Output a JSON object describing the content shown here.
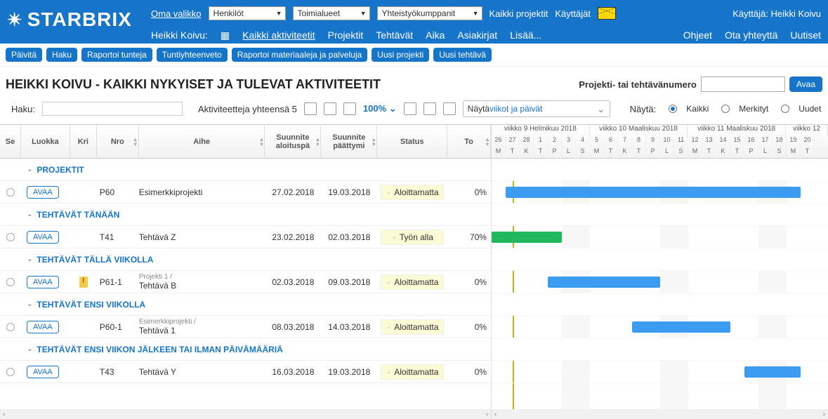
{
  "brand": "STARBRIX",
  "top": {
    "oma_valikko": "Oma valikko",
    "sel_henkilot": "Henkilöt",
    "sel_toimialueet": "Toimialueet",
    "sel_yhteistyo": "Yhteistyökumppanit",
    "kaikki_projektit": "Kaikki projektit",
    "kayttajat": "Käyttäjät",
    "user_prefix": "Käyttäjä:",
    "user_name": "Heikki Koivu"
  },
  "nav": {
    "user": "Heikki Koivu:",
    "kaikki_aktiviteetit": "Kaikki aktiviteetit",
    "projektit": "Projektit",
    "tehtavat": "Tehtävät",
    "aika": "Aika",
    "asiakirjat": "Asiakirjat",
    "lisaa": "Lisää...",
    "ohjeet": "Ohjeet",
    "ota_yhteytta": "Ota yhteyttä",
    "uutiset": "Uutiset"
  },
  "pills": {
    "paivita": "Päivitä",
    "haku": "Haku",
    "raportoi_tunteja": "Raportoi tunteja",
    "tuntiyhteenveto": "Tuntiyhteenveto",
    "raportoi_mat": "Raportoi materiaaleja ja palveluja",
    "uusi_projekti": "Uusi projekti",
    "uusi_tehtava": "Uusi tehtävä"
  },
  "title": "HEIKKI KOIVU - KAIKKI NYKYISET JA TULEVAT AKTIVITEETIT",
  "proj_search_label": "Projekti- tai tehtävänumero",
  "open_btn": "Avaa",
  "haku_label": "Haku:",
  "act_count": "Aktiviteetteja yhteensä 5",
  "zoom": "100%",
  "view_select_prefix": "Näytä ",
  "view_select_value": "viikot ja päivät",
  "show_label": "Näytä:",
  "radio_kaikki": "Kaikki",
  "radio_merkityt": "Merkityt",
  "radio_uudet": "Uudet",
  "cols": {
    "sel": "Se",
    "luokka": "Luokka",
    "kri": "Kri",
    "nro": "Nro",
    "aihe": "Aihe",
    "start": "Suunnite aloituspä",
    "end": "Suunnite päättymi",
    "status": "Status",
    "pct": "To"
  },
  "groups": {
    "g1": "PROJEKTIT",
    "g2": "TEHTÄVÄT TÄNÄÄN",
    "g3": "TEHTÄVÄT TÄLLÄ VIIKOLLA",
    "g4": "TEHTÄVÄT ENSI VIIKOLLA",
    "g5": "TEHTÄVÄT ENSI VIIKON JÄLKEEN TAI ILMAN PÄIVÄMÄÄRIÄ"
  },
  "rows": [
    {
      "avaa": "AVAA",
      "nro": "P60",
      "aihe": "Esimerkkiprojekti",
      "sub": "",
      "start": "27.02.2018",
      "end": "19.03.2018",
      "status": "Aloittamatta",
      "pct": "0%",
      "warn": false
    },
    {
      "avaa": "AVAA",
      "nro": "T41",
      "aihe": "Tehtävä Z",
      "sub": "",
      "start": "23.02.2018",
      "end": "02.03.2018",
      "status": "Työn alla",
      "pct": "70%",
      "warn": false
    },
    {
      "avaa": "AVAA",
      "nro": "P61-1",
      "aihe": "Tehtävä B",
      "sub": "Projekti 1 /",
      "start": "02.03.2018",
      "end": "09.03.2018",
      "status": "Aloittamatta",
      "pct": "0%",
      "warn": true
    },
    {
      "avaa": "AVAA",
      "nro": "P60-1",
      "aihe": "Tehtävä 1",
      "sub": "Esimerkkiprojekti /",
      "start": "08.03.2018",
      "end": "14.03.2018",
      "status": "Aloittamatta",
      "pct": "0%",
      "warn": false
    },
    {
      "avaa": "AVAA",
      "nro": "T43",
      "aihe": "Tehtävä Y",
      "sub": "",
      "start": "16.03.2018",
      "end": "19.03.2018",
      "status": "Aloittamatta",
      "pct": "0%",
      "warn": false
    }
  ],
  "weeks": [
    {
      "label": "viikko 9 Helmikuu 2018",
      "days": 7
    },
    {
      "label": "viikko 10 Maaliskuu 2018",
      "days": 7
    },
    {
      "label": "viikko 11 Maaliskuu 2018",
      "days": 7
    },
    {
      "label": "viikko 12",
      "days": 3
    }
  ],
  "days": [
    "26",
    "27",
    "28",
    "1",
    "2",
    "3",
    "4",
    "5",
    "6",
    "7",
    "8",
    "9",
    "10",
    "11",
    "12",
    "13",
    "14",
    "15",
    "16",
    "17",
    "18",
    "19",
    "20"
  ],
  "dows": [
    "M",
    "T",
    "K",
    "T",
    "P",
    "L",
    "S",
    "M",
    "T",
    "K",
    "T",
    "P",
    "L",
    "S",
    "M",
    "T",
    "K",
    "T",
    "P",
    "L",
    "S",
    "M",
    "T"
  ],
  "chart_data": {
    "type": "gantt",
    "date_range": {
      "start": "2018-02-26",
      "end": "2018-03-20"
    },
    "today": "2018-02-27",
    "bars": [
      {
        "row": 1,
        "name": "Esimerkkiprojekti",
        "start": "2018-02-27",
        "end": "2018-03-19",
        "color": "blue",
        "pct": 0
      },
      {
        "row": 3,
        "name": "Tehtävä Z",
        "start": "2018-02-23",
        "end": "2018-03-02",
        "color": "deepblue",
        "pct": 70,
        "progress_color": "green"
      },
      {
        "row": 5,
        "name": "Tehtävä B",
        "start": "2018-03-02",
        "end": "2018-03-09",
        "color": "blue",
        "pct": 0
      },
      {
        "row": 7,
        "name": "Tehtävä 1",
        "start": "2018-03-08",
        "end": "2018-03-14",
        "color": "blue",
        "pct": 0
      },
      {
        "row": 9,
        "name": "Tehtävä Y",
        "start": "2018-03-16",
        "end": "2018-03-19",
        "color": "blue",
        "pct": 0
      }
    ]
  }
}
